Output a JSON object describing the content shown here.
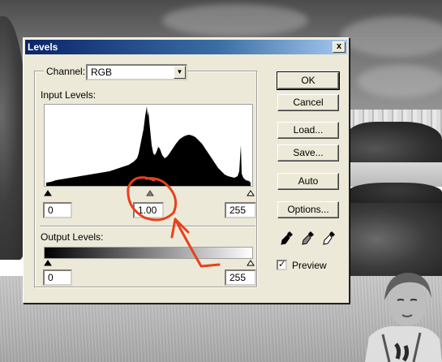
{
  "dialog": {
    "title": "Levels",
    "close_glyph": "x",
    "channel_label": "Channel:",
    "channel_value": "RGB",
    "input_levels_label": "Input Levels:",
    "input_black": "0",
    "input_gamma": "1.00",
    "input_white": "255",
    "output_levels_label": "Output Levels:",
    "output_black": "0",
    "output_white": "255"
  },
  "buttons": {
    "ok": "OK",
    "cancel": "Cancel",
    "load": "Load...",
    "save": "Save...",
    "auto": "Auto",
    "options": "Options..."
  },
  "preview": {
    "label": "Preview",
    "checked": true,
    "check_glyph": "✓"
  },
  "icons": {
    "black_eyedropper": "black-eyedropper-icon",
    "gray_eyedropper": "gray-eyedropper-icon",
    "white_eyedropper": "white-eyedropper-icon",
    "dropdown_arrow": "chevron-down-icon"
  },
  "colors": {
    "dialog_bg": "#ece9d8",
    "title_bar": "#0a246a",
    "annotation": "#e8401c"
  }
}
